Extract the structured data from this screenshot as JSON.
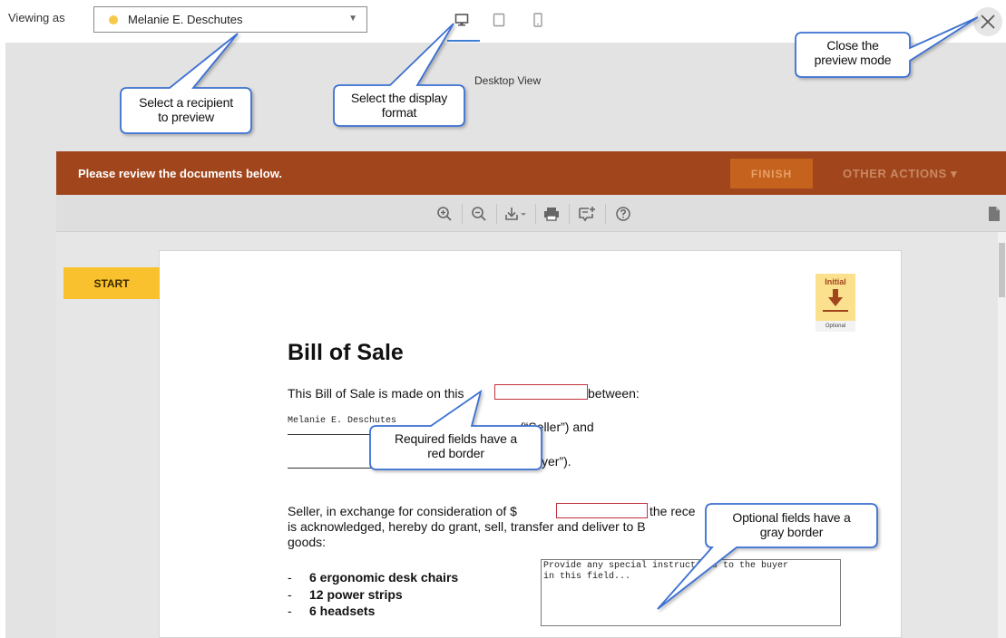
{
  "topbar": {
    "viewing_label": "Viewing as",
    "recipient": "Melanie E. Deschutes",
    "recipient_dot_color": "#f7c948",
    "devices": [
      "desktop-icon",
      "tablet-icon",
      "phone-icon"
    ],
    "selected_device": "desktop",
    "close_icon": "close-icon"
  },
  "stage": {
    "view_label": "Desktop View"
  },
  "action_bar": {
    "message": "Please review the documents below.",
    "finish_label": "FINISH",
    "other_actions_label": "OTHER ACTIONS ▾",
    "bar_color": "#a0451c"
  },
  "toolbar": {
    "icons": [
      "zoom-in-icon",
      "zoom-out-icon",
      "download-icon",
      "print-icon",
      "comment-icon",
      "help-icon",
      "page-icon"
    ]
  },
  "document": {
    "start_label": "START",
    "initial_tag": {
      "label": "Initial",
      "sub": "Optional"
    },
    "title": "Bill of Sale",
    "line1_before": "This Bill of Sale is made on this",
    "line1_after": "between:",
    "seller_name": "Melanie E. Deschutes",
    "seller_suffix": "(“Seller”) and",
    "buyer_suffix": "yer”).",
    "para_line1_before": "Seller, in exchange for consideration of $",
    "para_line1_after": "the rece",
    "para_line2": "is acknowledged, hereby do grant, sell, transfer and deliver to B",
    "para_line3": "goods:",
    "optional_field_text": "Provide any special instructions to the buyer\nin this field...",
    "items": [
      "6 ergonomic desk chairs",
      "12 power strips",
      "6 headsets"
    ]
  },
  "callouts": {
    "recipient": "Select a recipient\nto preview",
    "display": "Select the display\nformat",
    "close": "Close the\npreview mode",
    "required": "Required fields have a\nred border",
    "optional": "Optional fields have a\ngray border"
  }
}
